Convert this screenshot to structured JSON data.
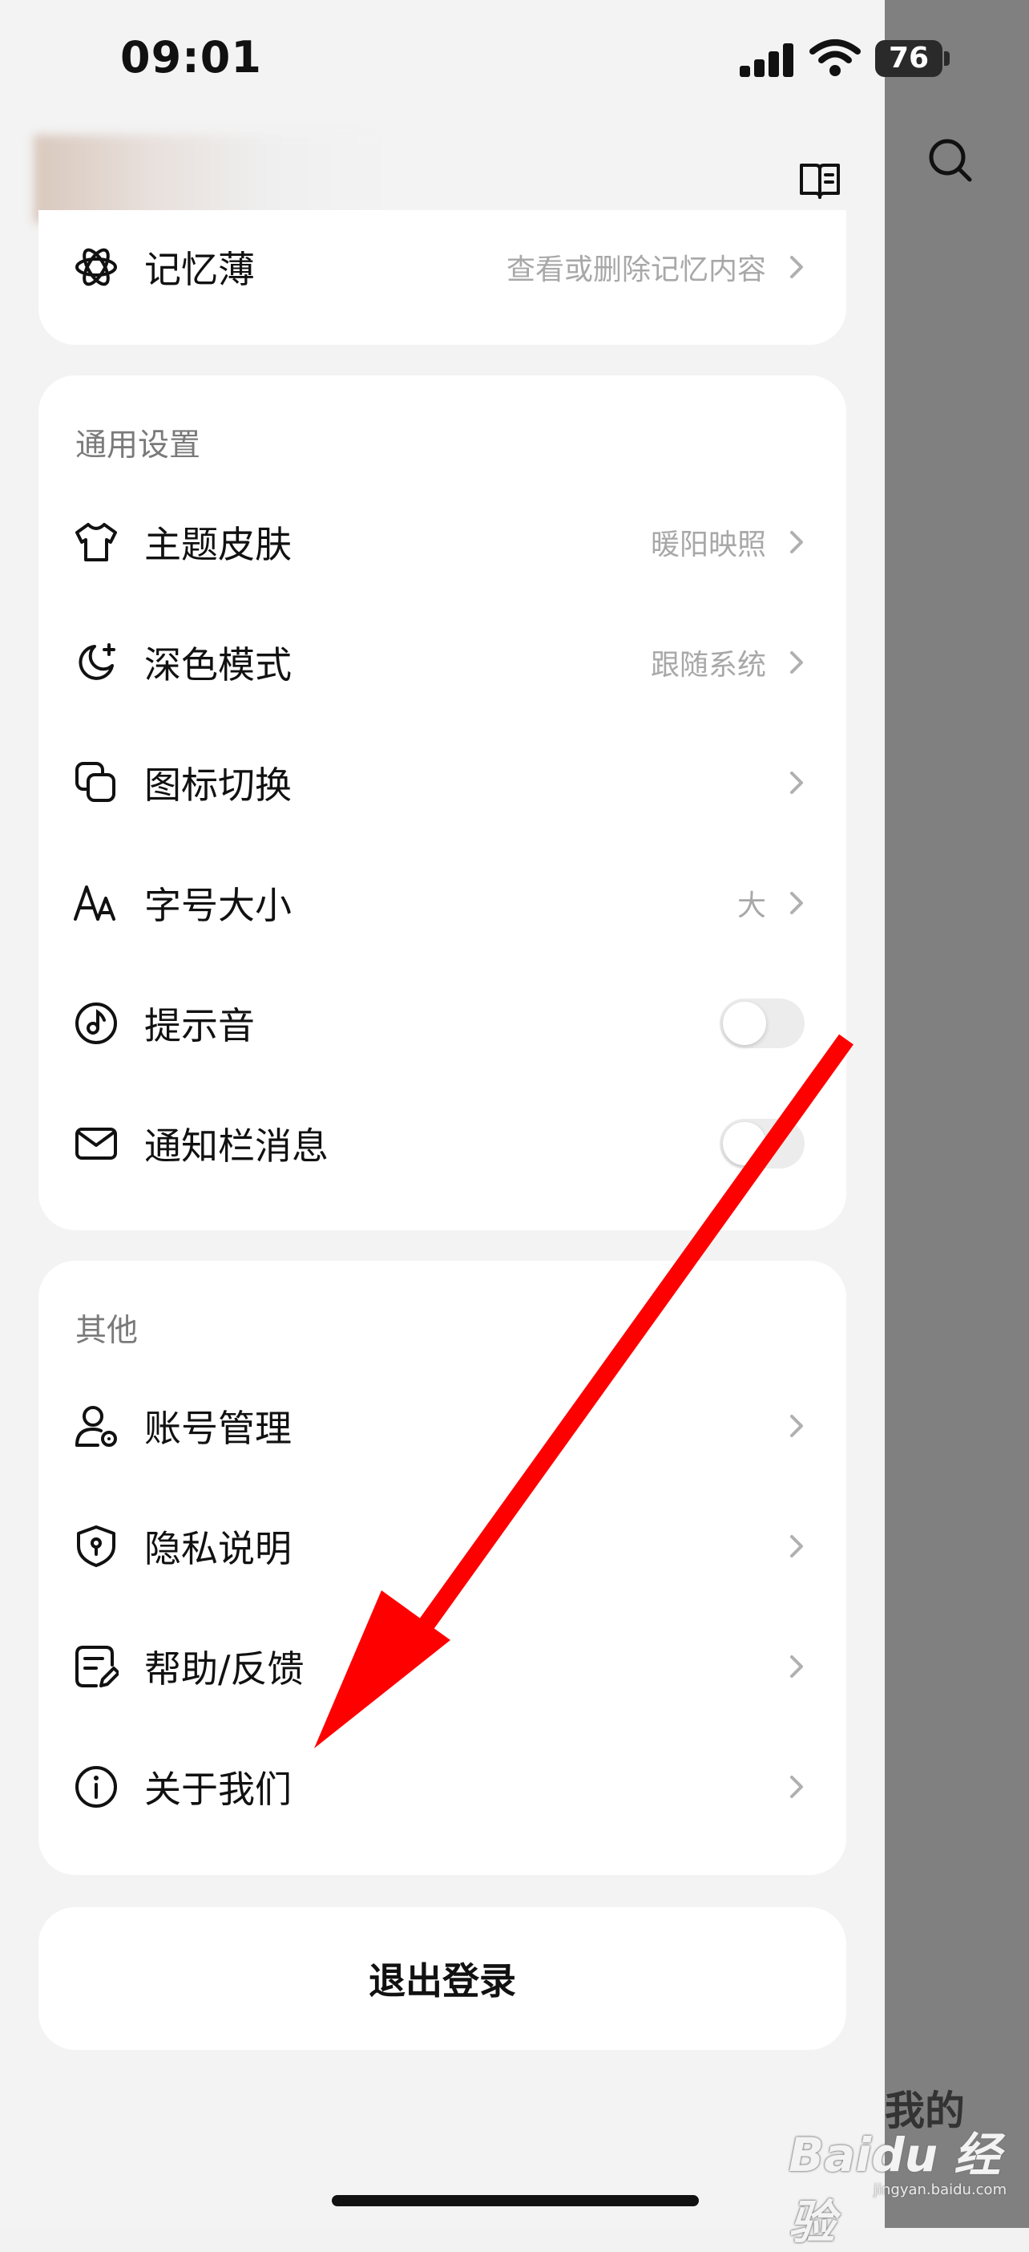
{
  "status_bar": {
    "time": "09:01",
    "battery": "76"
  },
  "memory": {
    "label": "记忆薄",
    "value": "查看或删除记忆内容"
  },
  "general": {
    "title": "通用设置",
    "items": [
      {
        "label": "主题皮肤",
        "value": "暖阳映照",
        "icon": "tshirt-icon"
      },
      {
        "label": "深色模式",
        "value": "跟随系统",
        "icon": "moon-icon"
      },
      {
        "label": "图标切换",
        "value": "",
        "icon": "layers-icon"
      },
      {
        "label": "字号大小",
        "value": "大",
        "icon": "font-size-icon"
      },
      {
        "label": "提示音",
        "toggle": false,
        "icon": "sound-icon"
      },
      {
        "label": "通知栏消息",
        "toggle": false,
        "icon": "mail-icon"
      }
    ]
  },
  "other": {
    "title": "其他",
    "items": [
      {
        "label": "账号管理",
        "icon": "account-icon"
      },
      {
        "label": "隐私说明",
        "icon": "shield-icon"
      },
      {
        "label": "帮助/反馈",
        "icon": "feedback-icon"
      },
      {
        "label": "关于我们",
        "icon": "info-icon"
      }
    ]
  },
  "logout": {
    "label": "退出登录"
  },
  "side_tab": {
    "label": "我的"
  },
  "watermark": {
    "text": "Baidu 经验",
    "sub": "jingyan.baidu.com"
  },
  "colors": {
    "overlay": "#808080",
    "card": "#ffffff",
    "background": "#f3f3f3",
    "arrow": "#ff0000",
    "muted": "#a8a8a8"
  }
}
